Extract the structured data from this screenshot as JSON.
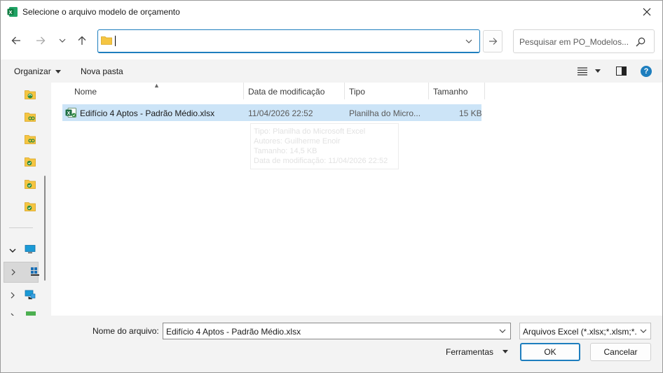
{
  "window": {
    "title": "Selecione o arquivo modelo de orçamento"
  },
  "address": {
    "path": ""
  },
  "search": {
    "placeholder": "Pesquisar em PO_Modelos..."
  },
  "toolbar": {
    "organize": "Organizar",
    "new_folder": "Nova pasta"
  },
  "columns": {
    "name": "Nome",
    "date": "Data de modificação",
    "type": "Tipo",
    "size": "Tamanho"
  },
  "files": [
    {
      "name": "Edifício 4 Aptos - Padrão Médio.xlsx",
      "date": "11/04/2026 22:52",
      "type": "Planilha do Micro...",
      "size": "15 KB"
    }
  ],
  "tooltip": {
    "line1": "Tipo: Planilha do Microsoft Excel",
    "line2": "Autores: Guilherme Enoir",
    "line3": "Tamanho: 14,5 KB",
    "line4": "Data de modificação: 11/04/2026 22:52"
  },
  "footer": {
    "filename_label": "Nome do arquivo:",
    "filename_value": "Edifício 4 Aptos - Padrão Médio.xlsx",
    "filter": "Arquivos Excel (*.xlsx;*.xlsm;*.xl",
    "tools": "Ferramentas",
    "ok": "OK",
    "cancel": "Cancelar"
  },
  "colors": {
    "accent": "#1e7ebe",
    "selection": "#cce4f7",
    "excel_green": "#1d6f42",
    "folder_yellow": "#f5c542"
  }
}
